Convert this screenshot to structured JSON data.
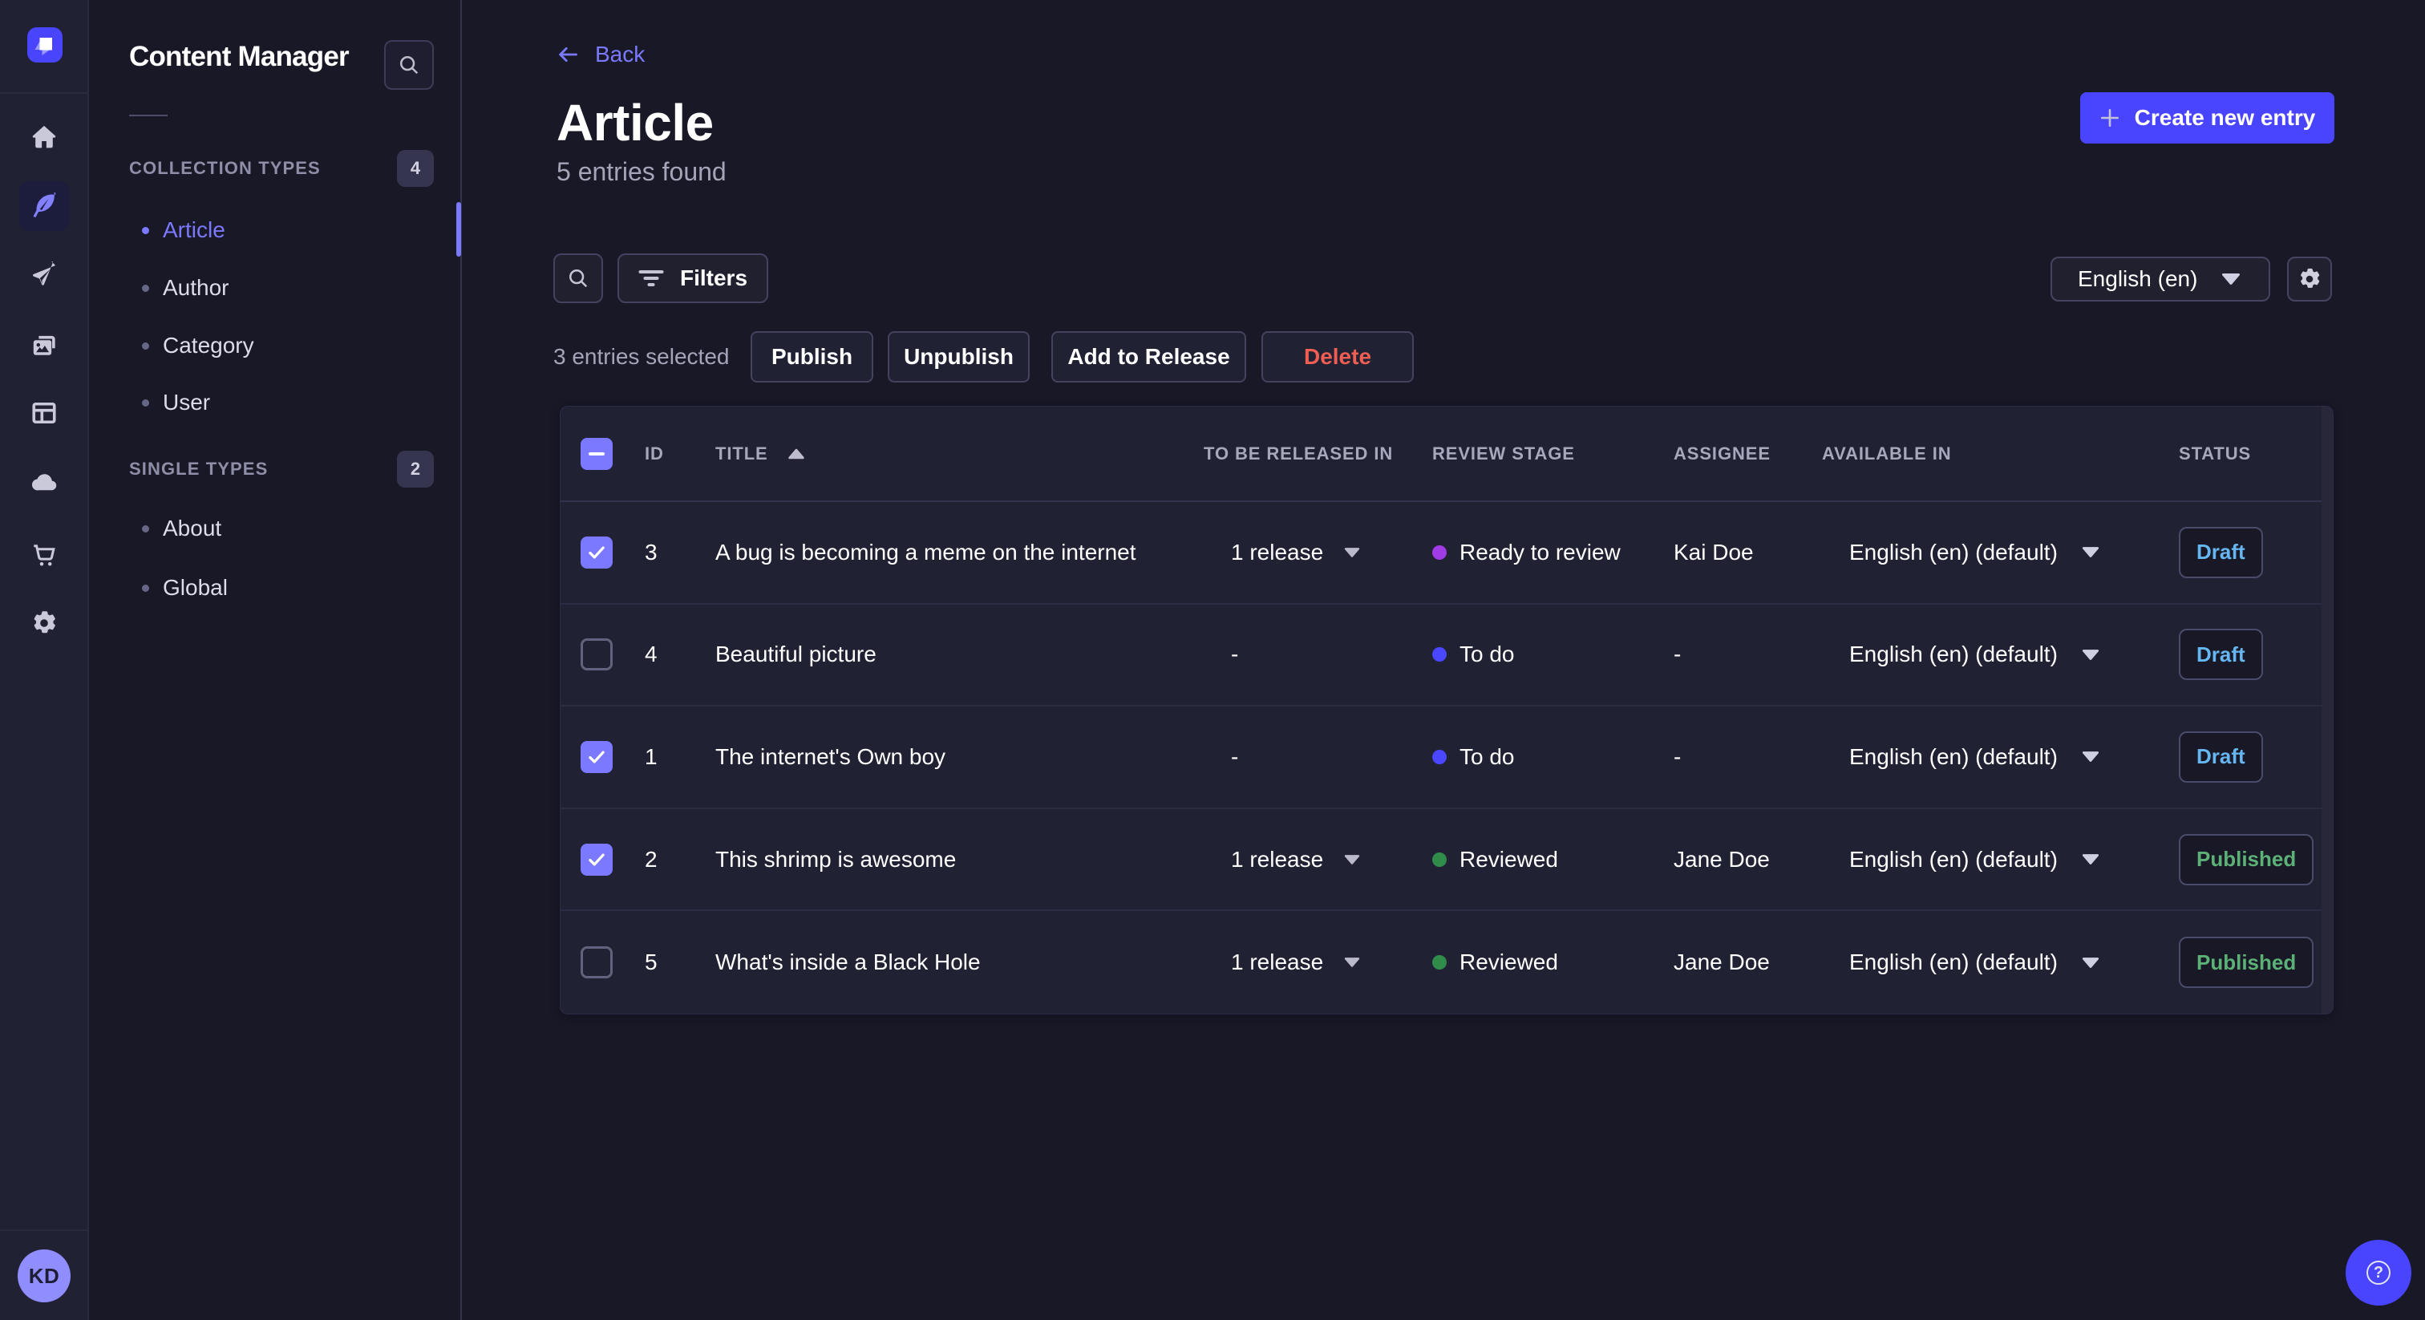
{
  "app": {
    "accent_color": "#4945ff",
    "active_item_color": "#7b79ff"
  },
  "rail": {
    "logo": "strapi",
    "items": [
      {
        "name": "home",
        "active": false
      },
      {
        "name": "content-manager",
        "active": true
      },
      {
        "name": "releases",
        "active": false
      },
      {
        "name": "media-library",
        "active": false
      },
      {
        "name": "content-type-builder",
        "active": false
      },
      {
        "name": "deploy",
        "active": false
      },
      {
        "name": "marketplace",
        "active": false
      },
      {
        "name": "settings",
        "active": false
      }
    ],
    "avatar_initials": "KD"
  },
  "sidebar": {
    "title": "Content Manager",
    "sections": [
      {
        "label": "COLLECTION TYPES",
        "badge": "4",
        "items": [
          {
            "label": "Article",
            "active": true
          },
          {
            "label": "Author",
            "active": false
          },
          {
            "label": "Category",
            "active": false
          },
          {
            "label": "User",
            "active": false
          }
        ]
      },
      {
        "label": "SINGLE TYPES",
        "badge": "2",
        "items": [
          {
            "label": "About",
            "active": false
          },
          {
            "label": "Global",
            "active": false
          }
        ]
      }
    ]
  },
  "header": {
    "back_label": "Back",
    "title": "Article",
    "subtitle": "5 entries found",
    "create_label": "Create new entry"
  },
  "toolbar": {
    "filters_label": "Filters",
    "locale_value": "English (en)"
  },
  "selection": {
    "summary": "3 entries selected",
    "publish_label": "Publish",
    "unpublish_label": "Unpublish",
    "add_to_release_label": "Add to Release",
    "delete_label": "Delete"
  },
  "table": {
    "columns": {
      "id": "ID",
      "title": "TITLE",
      "released": "TO BE RELEASED IN",
      "review": "REVIEW STAGE",
      "assignee": "ASSIGNEE",
      "available": "AVAILABLE IN",
      "status": "STATUS"
    },
    "header_checkbox_state": "indeterminate",
    "rows": [
      {
        "selected": "true",
        "id": "3",
        "title": "A bug is becoming a meme on the internet",
        "released": "1 release",
        "has_release": "true",
        "review_stage": "Ready to review",
        "review_color": "#a03ce6",
        "assignee": "Kai Doe",
        "available": "English (en) (default)",
        "status": "Draft",
        "status_color": "#66b7f1"
      },
      {
        "selected": "false",
        "id": "4",
        "title": "Beautiful picture",
        "released": "-",
        "has_release": "false",
        "review_stage": "To do",
        "review_color": "#4b46ff",
        "assignee": "-",
        "available": "English (en) (default)",
        "status": "Draft",
        "status_color": "#66b7f1"
      },
      {
        "selected": "true",
        "id": "1",
        "title": "The internet's Own boy",
        "released": "-",
        "has_release": "false",
        "review_stage": "To do",
        "review_color": "#4b46ff",
        "assignee": "-",
        "available": "English (en) (default)",
        "status": "Draft",
        "status_color": "#66b7f1"
      },
      {
        "selected": "true",
        "id": "2",
        "title": "This shrimp is awesome",
        "released": "1 release",
        "has_release": "true",
        "review_stage": "Reviewed",
        "review_color": "#2f8c4b",
        "assignee": "Jane Doe",
        "available": "English (en) (default)",
        "status": "Published",
        "status_color": "#5cb176"
      },
      {
        "selected": "false",
        "id": "5",
        "title": "What's inside a Black Hole",
        "released": "1 release",
        "has_release": "true",
        "review_stage": "Reviewed",
        "review_color": "#2f8c4b",
        "assignee": "Jane Doe",
        "available": "English (en) (default)",
        "status": "Published",
        "status_color": "#5cb176"
      }
    ]
  },
  "help": {
    "label": "?"
  }
}
